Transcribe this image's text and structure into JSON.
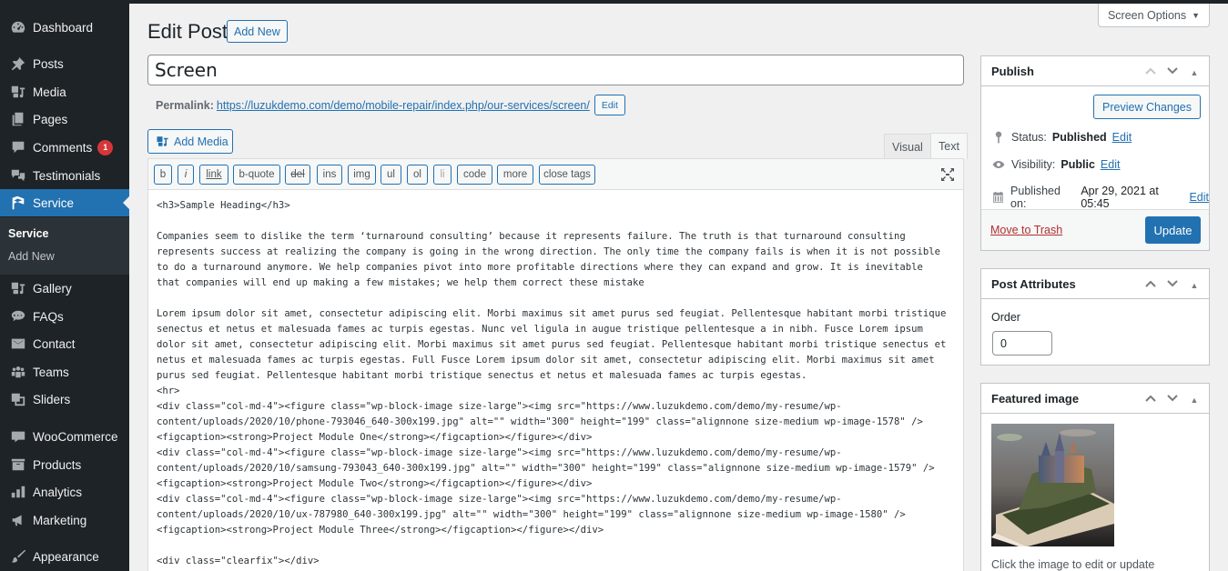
{
  "sidebar": {
    "items": [
      {
        "label": "Dashboard",
        "icon": "dashboard-icon"
      },
      {
        "label": "Posts",
        "icon": "pin-icon"
      },
      {
        "label": "Media",
        "icon": "media-icon"
      },
      {
        "label": "Pages",
        "icon": "pages-icon"
      },
      {
        "label": "Comments",
        "icon": "comment-icon",
        "badge": "1"
      },
      {
        "label": "Testimonials",
        "icon": "testimonials-icon"
      },
      {
        "label": "Service",
        "icon": "graduation-cap-icon",
        "active": true
      },
      {
        "label": "Gallery",
        "icon": "gallery-icon"
      },
      {
        "label": "FAQs",
        "icon": "faq-icon"
      },
      {
        "label": "Contact",
        "icon": "envelope-icon"
      },
      {
        "label": "Teams",
        "icon": "groups-icon"
      },
      {
        "label": "Sliders",
        "icon": "slides-icon"
      },
      {
        "label": "WooCommerce",
        "icon": "woo-icon"
      },
      {
        "label": "Products",
        "icon": "archive-icon"
      },
      {
        "label": "Analytics",
        "icon": "bar-chart-icon"
      },
      {
        "label": "Marketing",
        "icon": "megaphone-icon"
      },
      {
        "label": "Appearance",
        "icon": "brush-icon"
      }
    ],
    "submenu": [
      "Service",
      "Add New"
    ]
  },
  "header": {
    "screen_options": "Screen Options",
    "title": "Edit Post",
    "add_new": "Add New"
  },
  "post": {
    "title": "Screen",
    "permalink_label": "Permalink:",
    "permalink_url": "https://luzukdemo.com/demo/mobile-repair/index.php/our-services/screen/",
    "permalink_edit": "Edit"
  },
  "editor": {
    "add_media": "Add Media",
    "tabs": [
      "Visual",
      "Text"
    ],
    "active_tab": "Text",
    "quicktags": [
      "b",
      "i",
      "link",
      "b-quote",
      "del",
      "ins",
      "img",
      "ul",
      "ol",
      "li",
      "code",
      "more",
      "close tags"
    ],
    "content": "<h3>Sample Heading</h3>\n\nCompanies seem to dislike the term ‘turnaround consulting’ because it represents failure. The truth is that turnaround consulting\nrepresents success at realizing the company is going in the wrong direction. The only time the company fails is when it is not possible\nto do a turnaround anymore. We help companies pivot into more profitable directions where they can expand and grow. It is inevitable\nthat companies will end up making a few mistakes; we help them correct these mistake\n\nLorem ipsum dolor sit amet, consectetur adipiscing elit. Morbi maximus sit amet purus sed feugiat. Pellentesque habitant morbi tristique\nsenectus et netus et malesuada fames ac turpis egestas. Nunc vel ligula in augue tristique pellentesque a in nibh. Fusce Lorem ipsum\ndolor sit amet, consectetur adipiscing elit. Morbi maximus sit amet purus sed feugiat. Pellentesque habitant morbi tristique senectus et\nnetus et malesuada fames ac turpis egestas. Full Fusce Lorem ipsum dolor sit amet, consectetur adipiscing elit. Morbi maximus sit amet\npurus sed feugiat. Pellentesque habitant morbi tristique senectus et netus et malesuada fames ac turpis egestas.\n<hr>\n<div class=\"col-md-4\"><figure class=\"wp-block-image size-large\"><img src=\"https://www.luzukdemo.com/demo/my-resume/wp-\ncontent/uploads/2020/10/phone-793046_640-300x199.jpg\" alt=\"\" width=\"300\" height=\"199\" class=\"alignnone size-medium wp-image-1578\" />\n<figcaption><strong>Project Module One</strong></figcaption></figure></div>\n<div class=\"col-md-4\"><figure class=\"wp-block-image size-large\"><img src=\"https://www.luzukdemo.com/demo/my-resume/wp-\ncontent/uploads/2020/10/samsung-793043_640-300x199.jpg\" alt=\"\" width=\"300\" height=\"199\" class=\"alignnone size-medium wp-image-1579\" />\n<figcaption><strong>Project Module Two</strong></figcaption></figure></div>\n<div class=\"col-md-4\"><figure class=\"wp-block-image size-large\"><img src=\"https://www.luzukdemo.com/demo/my-resume/wp-\ncontent/uploads/2020/10/ux-787980_640-300x199.jpg\" alt=\"\" width=\"300\" height=\"199\" class=\"alignnone size-medium wp-image-1580\" />\n<figcaption><strong>Project Module Three</strong></figcaption></figure></div>\n\n<div class=\"clearfix\"></div>"
  },
  "publish": {
    "title": "Publish",
    "preview": "Preview Changes",
    "status_label": "Status:",
    "status_value": "Published",
    "visibility_label": "Visibility:",
    "visibility_value": "Public",
    "published_label": "Published on:",
    "published_value": "Apr 29, 2021 at 05:45",
    "edit": "Edit",
    "trash": "Move to Trash",
    "update": "Update"
  },
  "attributes": {
    "title": "Post Attributes",
    "order_label": "Order",
    "order_value": "0"
  },
  "featured": {
    "title": "Featured image",
    "caption": "Click the image to edit or update"
  }
}
